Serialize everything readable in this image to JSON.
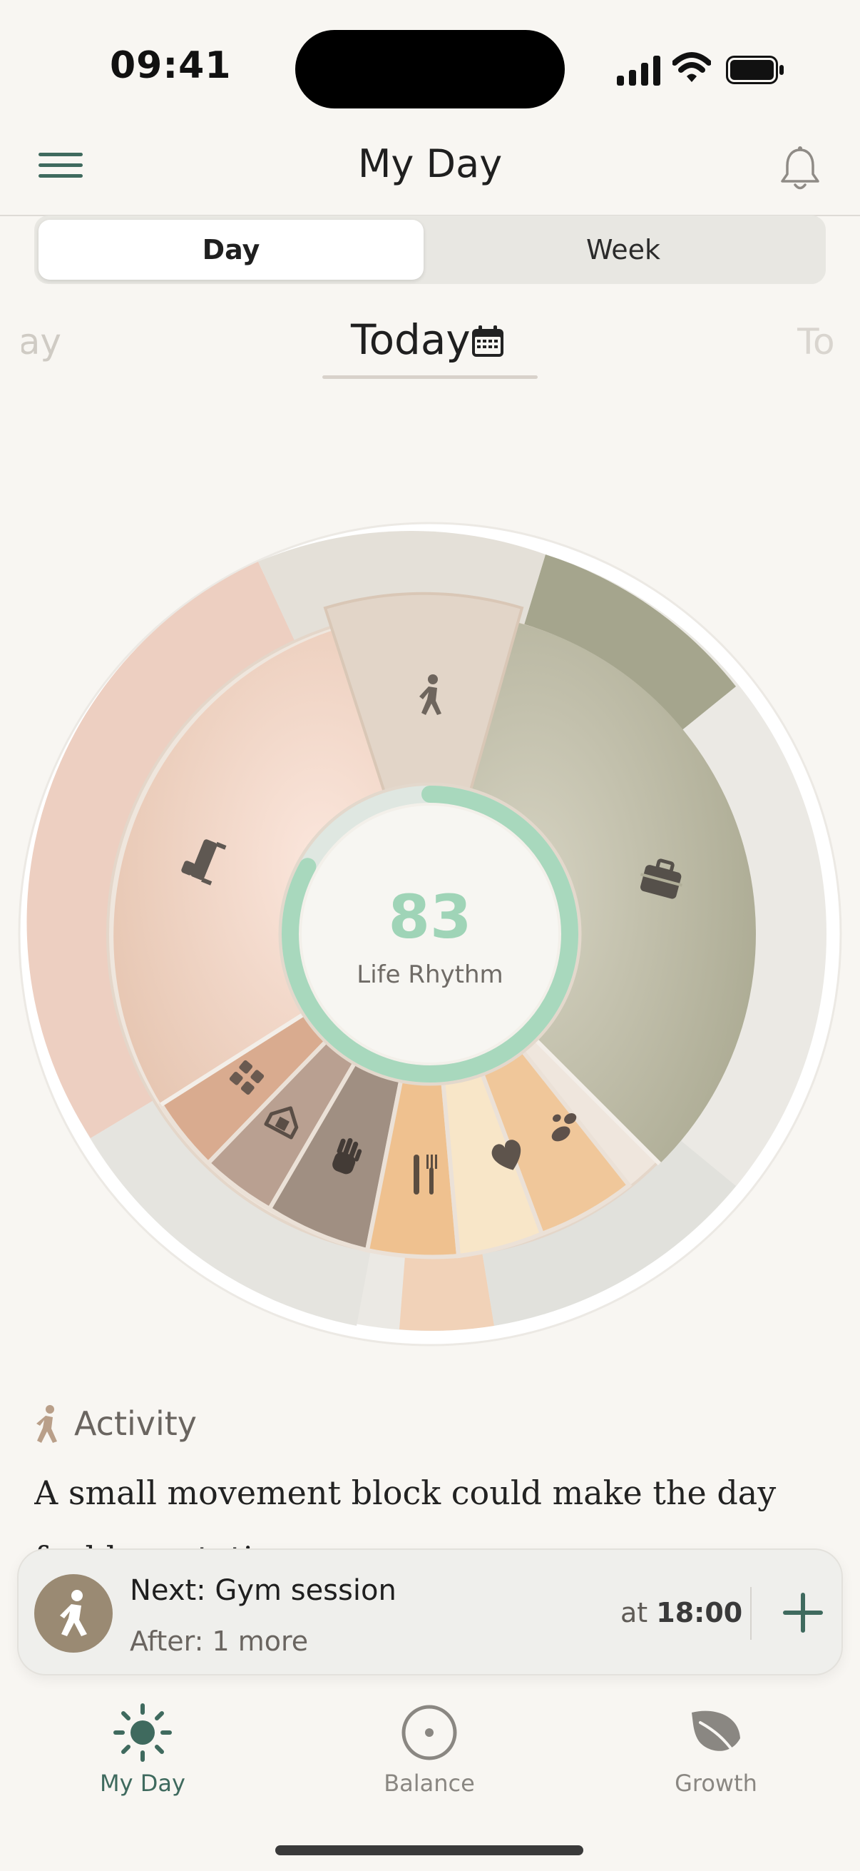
{
  "status": {
    "time": "09:41"
  },
  "header": {
    "title": "My Day"
  },
  "segmented": {
    "day": "Day",
    "week": "Week",
    "selected": "Day"
  },
  "date_scroller": {
    "prev": "ay",
    "current": "Today",
    "next": "To"
  },
  "wheel": {
    "score": "83",
    "score_label": "Life Rhythm",
    "score_ring_fraction": 0.83,
    "segments": [
      "activity",
      "work",
      "social",
      "love",
      "meals",
      "self-care",
      "chores",
      "home",
      "sleep"
    ],
    "colors": {
      "sleep": "#efd6cb",
      "work": "#b9b8a3",
      "meals": "#f0c896",
      "ring": "#a8d8bd"
    }
  },
  "insight": {
    "title": "Activity",
    "text": "A small movement block could make the day feel less static."
  },
  "next_card": {
    "title": "Next: Gym session",
    "subtitle": "After: 1 more",
    "time_prefix": "at",
    "time": "18:00"
  },
  "tabs": [
    {
      "label": "My Day",
      "icon": "sun-icon",
      "active": true
    },
    {
      "label": "Balance",
      "icon": "target-icon",
      "active": false
    },
    {
      "label": "Growth",
      "icon": "leaf-icon",
      "active": false
    }
  ]
}
